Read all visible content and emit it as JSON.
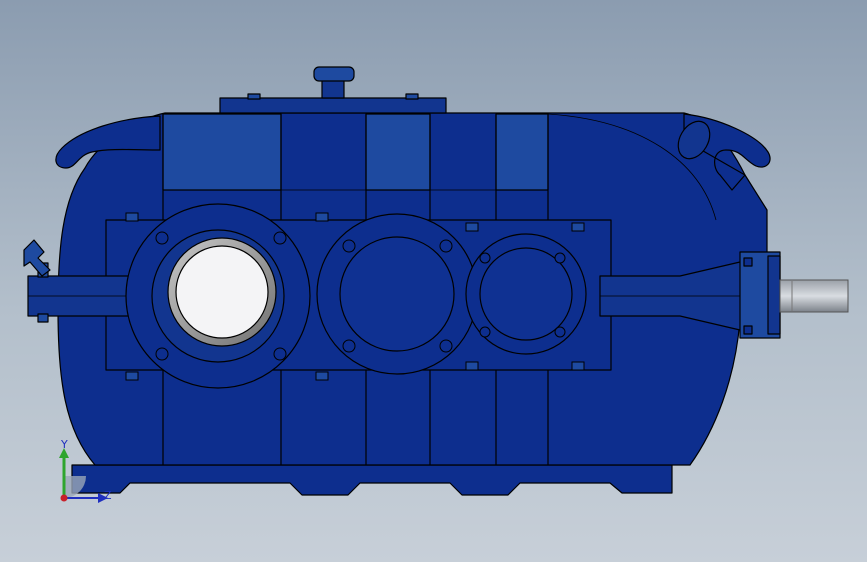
{
  "viewport": {
    "background_top": "#8b9cb0",
    "background_bottom": "#c7cfd8",
    "body_color": "#0d2e8e",
    "panel_color": "#1e4aa0",
    "outline_color": "#000000"
  },
  "triad": {
    "y_label": "Y",
    "z_label": "Z",
    "y_axis_color": "#2ea52e",
    "z_axis_color": "#1f2fbf",
    "origin_color": "#c8202a"
  }
}
